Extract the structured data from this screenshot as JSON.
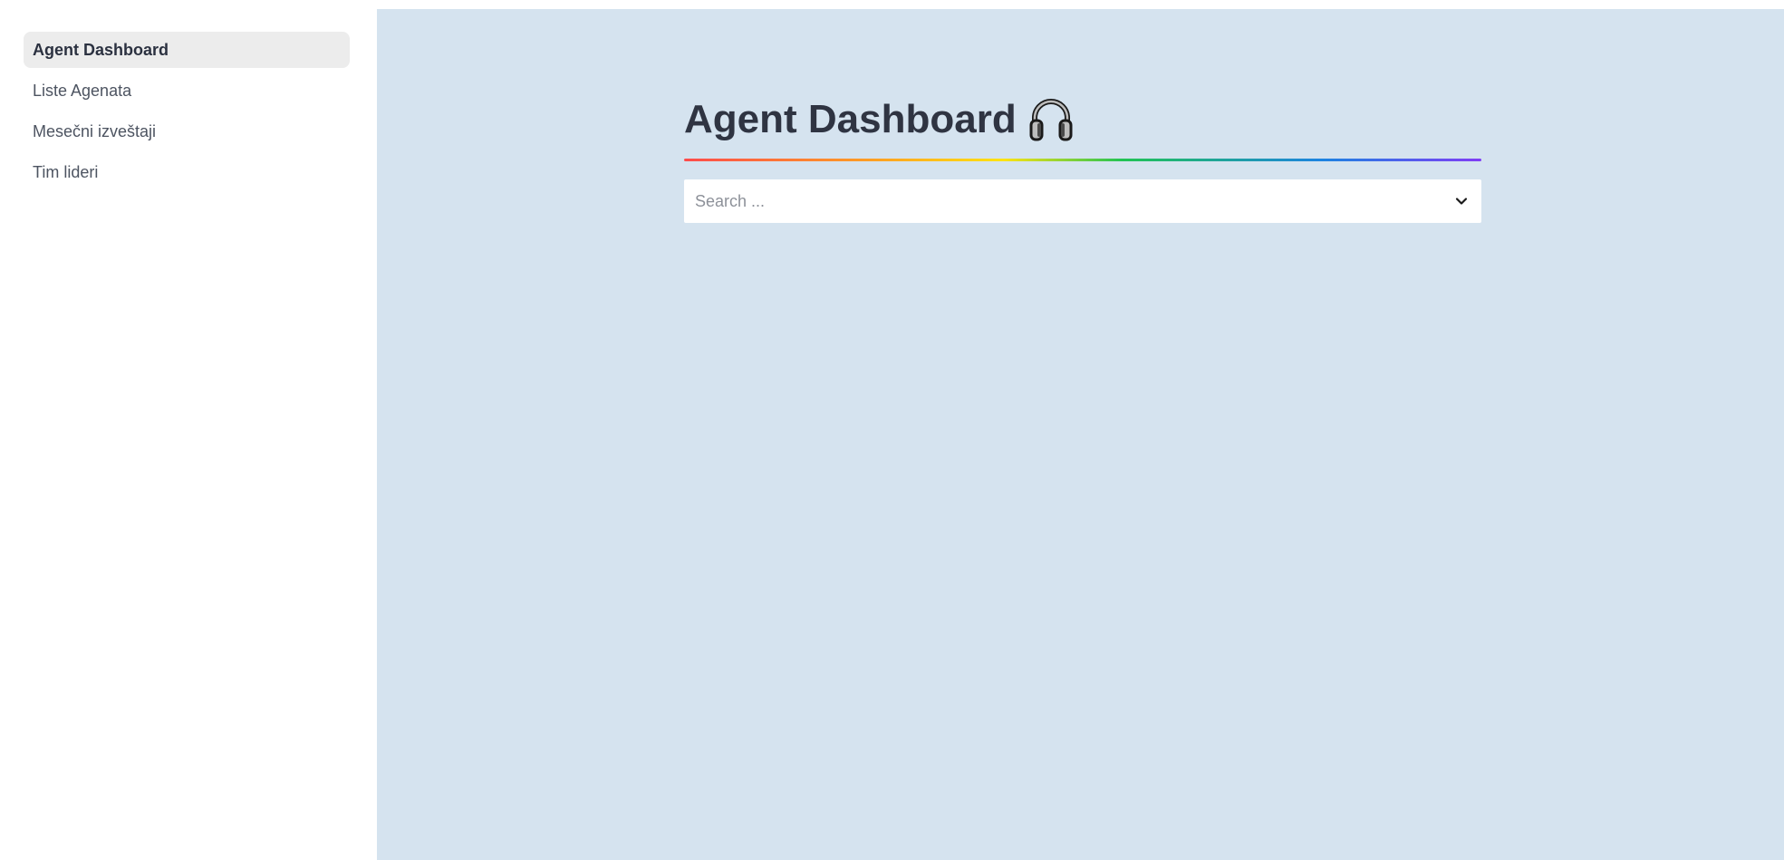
{
  "sidebar": {
    "items": [
      {
        "label": "Agent Dashboard",
        "active": true
      },
      {
        "label": "Liste Agenata",
        "active": false
      },
      {
        "label": "Mesečni izveštaji",
        "active": false
      },
      {
        "label": "Tim lideri",
        "active": false
      }
    ]
  },
  "main": {
    "title": "Agent Dashboard",
    "title_icon": "headphone-icon",
    "search": {
      "placeholder": "Search ...",
      "value": ""
    }
  },
  "colors": {
    "main_background": "#d5e3ef",
    "sidebar_background": "#ffffff",
    "active_item_background": "#ececec",
    "title_color": "#2f3442"
  }
}
